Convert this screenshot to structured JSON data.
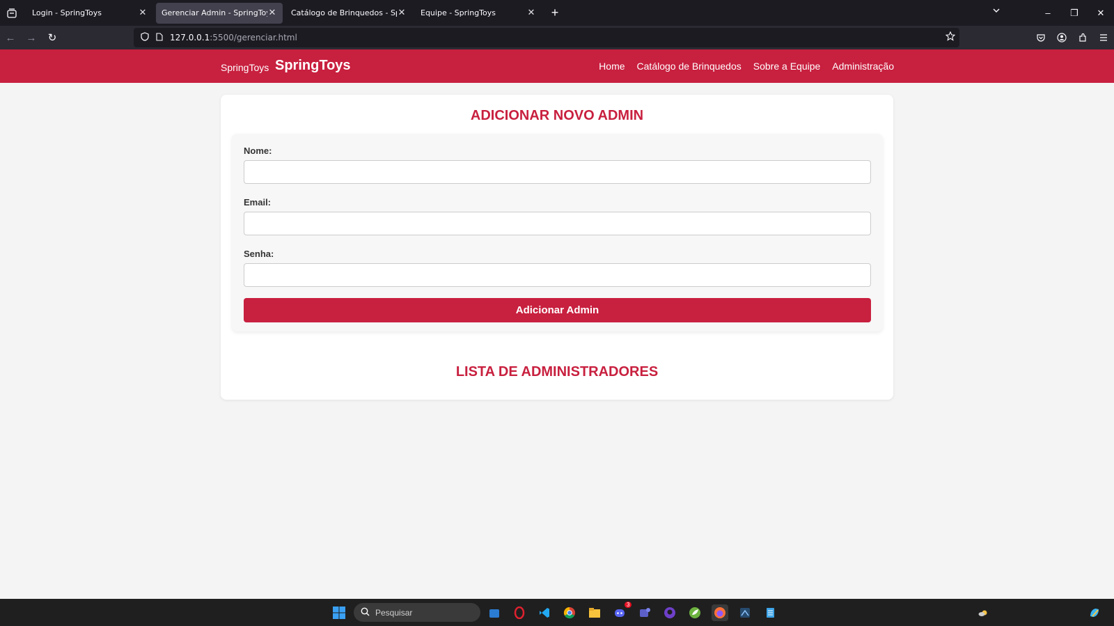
{
  "browser": {
    "tabs": [
      {
        "title": "Login - SpringToys",
        "active": false
      },
      {
        "title": "Gerenciar Admin - SpringToys",
        "active": true
      },
      {
        "title": "Catálogo de Brinquedos - SpringToys",
        "active": false
      },
      {
        "title": "Equipe - SpringToys",
        "active": false
      }
    ],
    "url_host": "127.0.0.1",
    "url_path": ":5500/gerenciar.html"
  },
  "site": {
    "brand_small": "SpringToys",
    "brand_big": "SpringToys",
    "nav": [
      "Home",
      "Catálogo de Brinquedos",
      "Sobre a Equipe",
      "Administração"
    ]
  },
  "form": {
    "title": "ADICIONAR NOVO ADMIN",
    "name_label": "Nome:",
    "email_label": "Email:",
    "password_label": "Senha:",
    "name_value": "",
    "email_value": "",
    "password_value": "",
    "submit_label": "Adicionar Admin"
  },
  "list": {
    "title": "LISTA DE ADMINISTRADORES"
  },
  "taskbar": {
    "search_placeholder": "Pesquisar",
    "discord_badge": "3"
  },
  "colors": {
    "brand": "#c8203f",
    "page_bg": "#f4f4f4"
  }
}
